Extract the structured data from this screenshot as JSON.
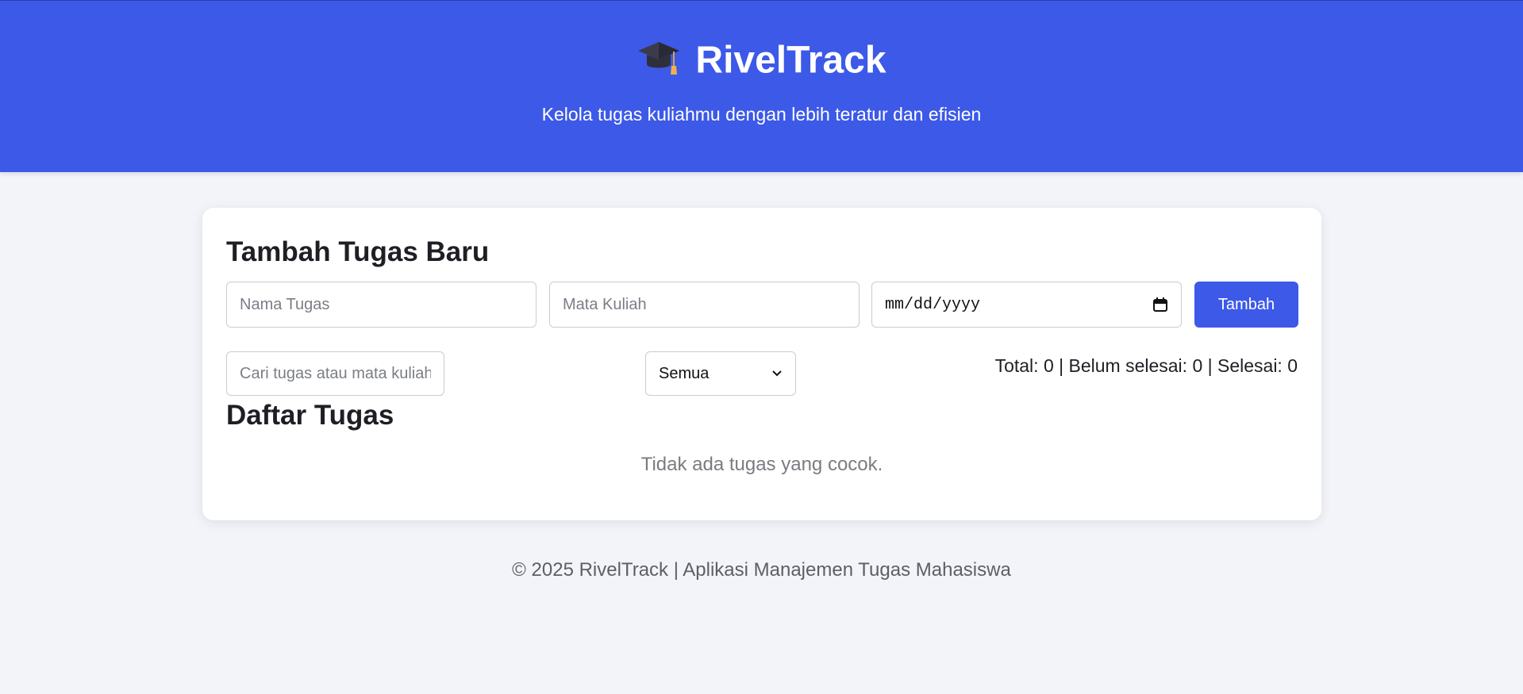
{
  "header": {
    "app_name": "RivelTrack",
    "icon": "graduation-cap-icon",
    "tagline": "Kelola tugas kuliahmu dengan lebih teratur dan efisien"
  },
  "add_form": {
    "title": "Tambah Tugas Baru",
    "task_name_placeholder": "Nama Tugas",
    "course_placeholder": "Mata Kuliah",
    "date_placeholder": "mm/dd/yyyy",
    "add_button_label": "Tambah"
  },
  "filters": {
    "search_placeholder": "Cari tugas atau mata kuliah",
    "status_selected": "Semua"
  },
  "stats": {
    "text": "Total: 0 | Belum selesai: 0 | Selesai: 0"
  },
  "task_list": {
    "title": "Daftar Tugas",
    "empty_message": "Tidak ada tugas yang cocok."
  },
  "footer": {
    "text": "© 2025 RivelTrack | Aplikasi Manajemen Tugas Mahasiswa"
  },
  "colors": {
    "primary": "#3c59e8",
    "background": "#f3f4f9",
    "card": "#ffffff"
  }
}
